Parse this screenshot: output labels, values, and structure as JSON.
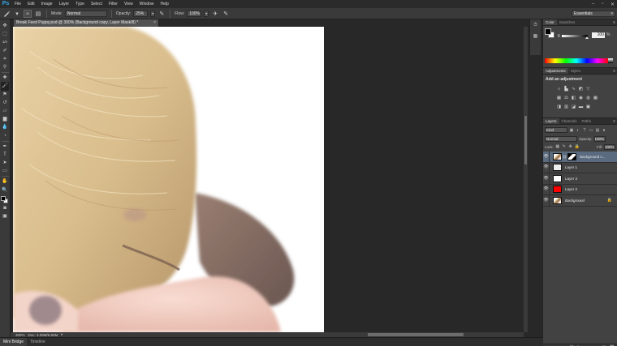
{
  "app": {
    "logo": "Ps",
    "menu": [
      "File",
      "Edit",
      "Image",
      "Layer",
      "Type",
      "Select",
      "Filter",
      "View",
      "Window",
      "Help"
    ],
    "window_controls": [
      "–",
      "▫",
      "✕"
    ]
  },
  "options": {
    "mode_label": "Mode:",
    "mode_value": "Normal",
    "opacity_label": "Opacity:",
    "opacity_value": "25%",
    "flow_label": "Flow:",
    "flow_value": "100%",
    "brush_size": "30",
    "workspace": "Essentials"
  },
  "document": {
    "tab_title": "Break Feed Puppy.psd @ 300% (Background copy, Layer Mask/8) *",
    "close": "×",
    "zoom": "300%",
    "doc_info": "Doc: 3.09M/6.84M"
  },
  "panels": {
    "color_tabs": [
      "Color",
      "Swatches"
    ],
    "k_label": "K",
    "k_value": "100",
    "k_unit": "%",
    "adj_tabs": [
      "Adjustments",
      "Styles"
    ],
    "adj_title": "Add an adjustment",
    "layers_tabs": [
      "Layers",
      "Channels",
      "Paths"
    ],
    "kind": "Kind",
    "blend": "Normal",
    "opacity_label": "Opacity:",
    "opacity_value": "100%",
    "lock_label": "Lock:",
    "fill_label": "Fill:",
    "fill_value": "100%"
  },
  "layers": [
    {
      "name": "Background c...",
      "thumb": "photo",
      "mask": true,
      "selected": true
    },
    {
      "name": "Layer 1",
      "thumb": "checker"
    },
    {
      "name": "Layer 3",
      "thumb": "white"
    },
    {
      "name": "Layer 2",
      "thumb": "red"
    },
    {
      "name": "Background",
      "thumb": "photo",
      "locked": true,
      "bg": true
    }
  ],
  "bottom_tabs": [
    "Mini Bridge",
    "Timeline"
  ],
  "colors": {
    "fg": "#000000",
    "bg": "#ffffff",
    "layer2_fill": "#ff0000",
    "selection": "#5a6b80"
  }
}
